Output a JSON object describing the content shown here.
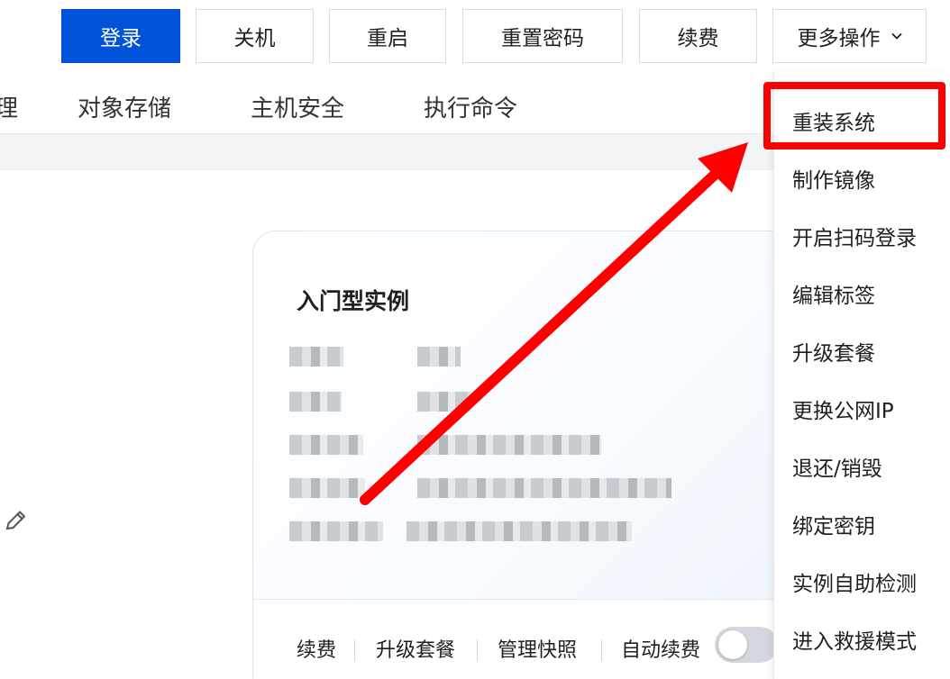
{
  "toolbar": {
    "login": "登录",
    "shutdown": "关机",
    "restart": "重启",
    "reset_password": "重置密码",
    "renew": "续费",
    "more_actions": "更多操作"
  },
  "tabs": {
    "partial": "理",
    "object_storage": "对象存储",
    "host_security": "主机安全",
    "execute_command": "执行命令"
  },
  "card": {
    "title": "入门型实例",
    "footer": {
      "renew": "续费",
      "upgrade": "升级套餐",
      "snapshots": "管理快照",
      "auto_renew": "自动续费"
    }
  },
  "menu": {
    "items": [
      "重装系统",
      "制作镜像",
      "开启扫码登录",
      "编辑标签",
      "升级套餐",
      "更换公网IP",
      "退还/销毁",
      "绑定密钥",
      "实例自助检测",
      "进入救援模式"
    ]
  },
  "colors": {
    "primary": "#0052d9",
    "annotation": "#ff0000"
  },
  "icons": {
    "edit": "pencil-icon",
    "dropdown": "chevron-down-icon"
  }
}
